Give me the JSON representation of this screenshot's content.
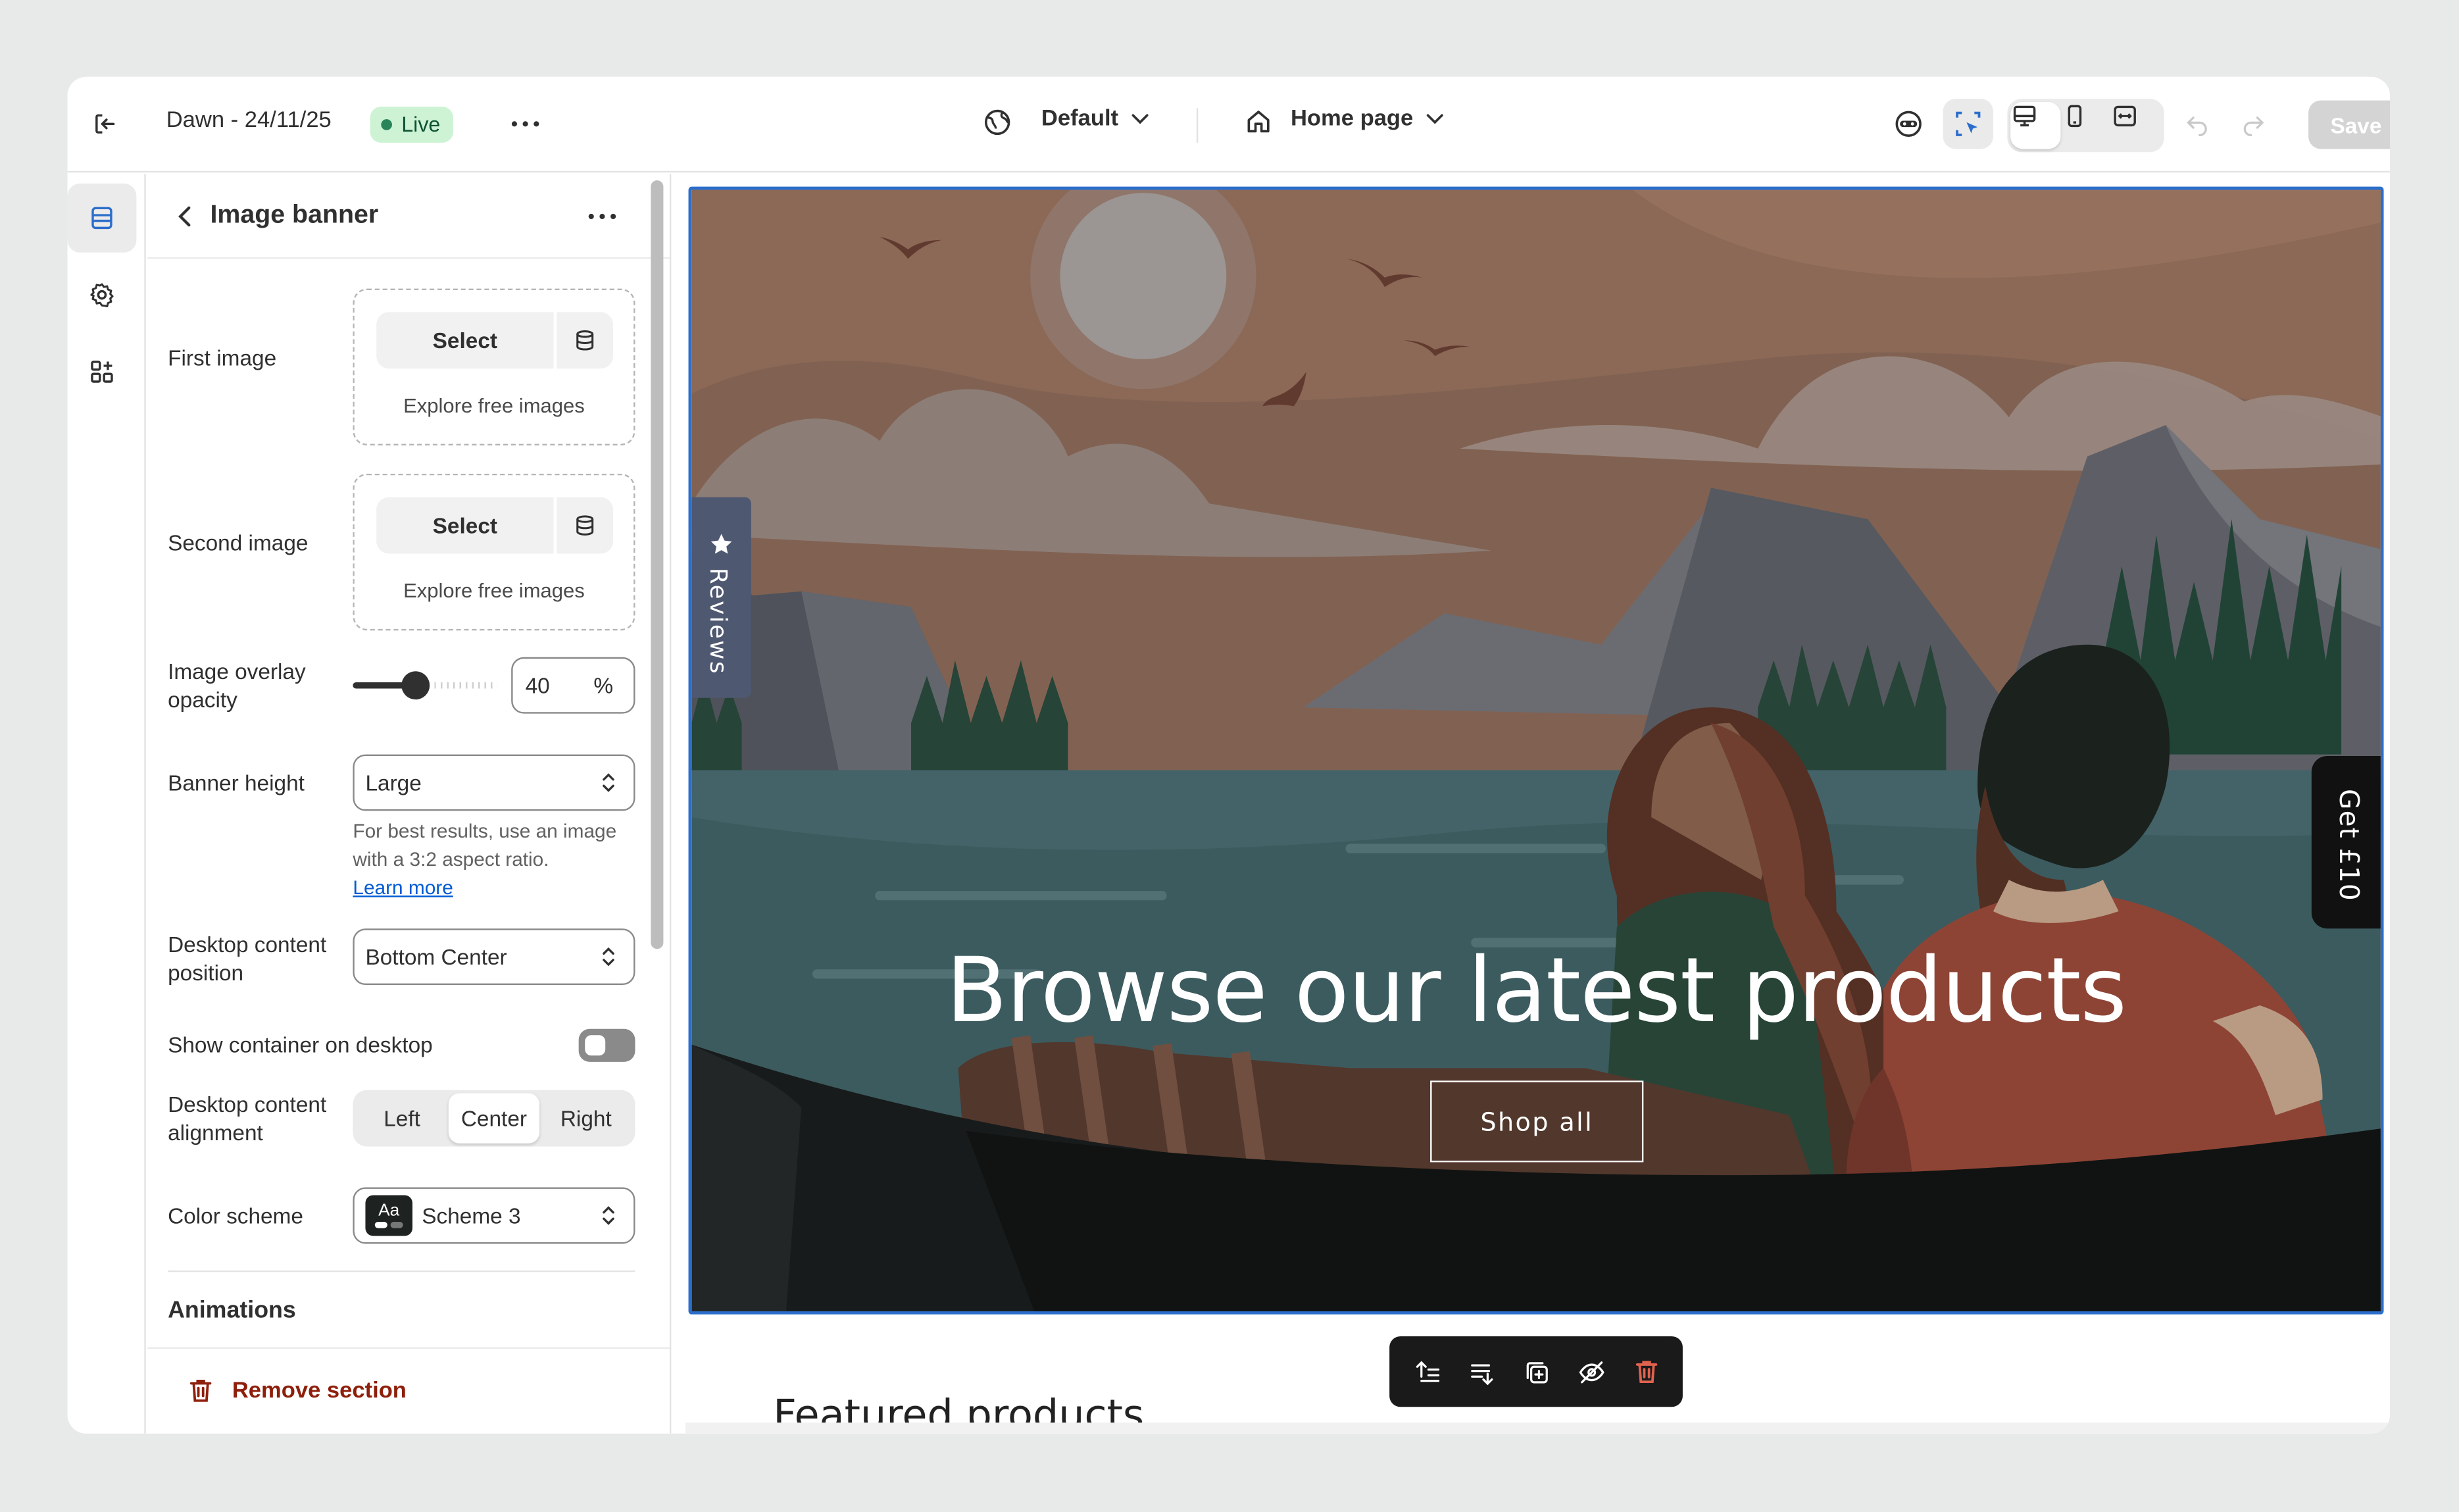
{
  "header": {
    "theme_name": "Dawn - 24/11/25",
    "status": "Live",
    "theme_selector": "Default",
    "page_selector": "Home page",
    "save_label": "Save"
  },
  "panel": {
    "title": "Image banner",
    "first_image_label": "First image",
    "second_image_label": "Second image",
    "select_label": "Select",
    "explore_label": "Explore free images",
    "overlay_label": "Image overlay opacity",
    "overlay_value": "40",
    "overlay_unit": "%",
    "overlay_fraction": 0.4,
    "banner_height_label": "Banner height",
    "banner_height_value": "Large",
    "banner_help": "For best results, use an image with a 3:2 aspect ratio.",
    "learn_more": "Learn more",
    "desktop_position_label": "Desktop content position",
    "desktop_position_value": "Bottom Center",
    "show_container_label": "Show container on desktop",
    "show_container_on": false,
    "alignment_label": "Desktop content alignment",
    "alignment_options": [
      "Left",
      "Center",
      "Right"
    ],
    "alignment_selected": "Center",
    "color_scheme_label": "Color scheme",
    "color_scheme_swatch": "Aa",
    "color_scheme_value": "Scheme 3",
    "animations_title": "Animations",
    "remove_label": "Remove section"
  },
  "preview": {
    "hero_title": "Browse our latest products",
    "hero_button": "Shop all",
    "reviews_tab": "Reviews",
    "promo_tab": "Get £10",
    "next_section_title": "Featured products"
  },
  "colors": {
    "accent": "#2c6ecb",
    "live_badge_bg": "#cdf3d4",
    "remove_red": "#8e1f0b"
  },
  "icons": {
    "exit": "exit-icon",
    "more": "more-horizontal-icon",
    "globe": "globe-icon",
    "home": "home-icon",
    "undo": "undo-icon",
    "redo": "redo-icon",
    "rail": [
      "sections-icon",
      "settings-gear-icon",
      "apps-icon"
    ]
  }
}
